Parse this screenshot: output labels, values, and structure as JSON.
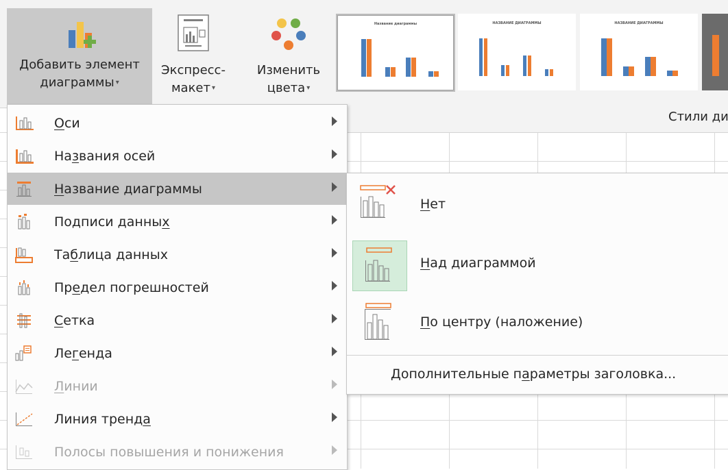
{
  "ribbon": {
    "add_element": {
      "line1": "Добавить элемент",
      "line2": "диаграммы"
    },
    "express_layout": {
      "line1": "Экспресс-",
      "line2": "макет"
    },
    "change_colors": {
      "line1": "Изменить",
      "line2": "цвета"
    },
    "gallery": [
      {
        "title": "Название диаграммы"
      },
      {
        "title": "НАЗВАНИЕ ДИАГРАММЫ"
      },
      {
        "title": "НАЗВАНИЕ ДИАГРАММЫ"
      }
    ],
    "styles_label": "Стили ди"
  },
  "menu": {
    "items": [
      {
        "pre": "",
        "u": "О",
        "post": "си",
        "icon": "axes-icon",
        "disabled": false
      },
      {
        "pre": "На",
        "u": "з",
        "post": "вания осей",
        "icon": "axis-titles-icon",
        "disabled": false
      },
      {
        "pre": "",
        "u": "Н",
        "post": "азвание диаграммы",
        "icon": "chart-title-icon",
        "disabled": false,
        "highlighted": true
      },
      {
        "pre": "Подписи данны",
        "u": "х",
        "post": "",
        "icon": "data-labels-icon",
        "disabled": false
      },
      {
        "pre": "Та",
        "u": "б",
        "post": "лица данных",
        "icon": "data-table-icon",
        "disabled": false
      },
      {
        "pre": "Пр",
        "u": "е",
        "post": "дел погрешностей",
        "icon": "error-bars-icon",
        "disabled": false
      },
      {
        "pre": "",
        "u": "С",
        "post": "етка",
        "icon": "gridlines-icon",
        "disabled": false
      },
      {
        "pre": "Ле",
        "u": "г",
        "post": "енда",
        "icon": "legend-icon",
        "disabled": false
      },
      {
        "pre": "",
        "u": "Л",
        "post": "инии",
        "icon": "lines-icon",
        "disabled": true
      },
      {
        "pre": "Линия тренд",
        "u": "а",
        "post": "",
        "icon": "trendline-icon",
        "disabled": false
      },
      {
        "pre": "Полосы повышения и понижения",
        "u": "",
        "post": "",
        "icon": "up-down-bars-icon",
        "disabled": true
      }
    ]
  },
  "submenu": {
    "items": [
      {
        "pre": "",
        "u": "Н",
        "post": "ет",
        "icon": "no-title-icon"
      },
      {
        "pre": "",
        "u": "Н",
        "post": "ад диаграммой",
        "icon": "above-chart-icon",
        "selected": true
      },
      {
        "pre": "",
        "u": "П",
        "post": "о центру (наложение)",
        "icon": "centered-overlay-icon"
      }
    ],
    "more": {
      "pre": "Дополнительные п",
      "u": "а",
      "post": "раметры заголовка..."
    }
  },
  "colors": {
    "accent_orange": "#ed7d31",
    "accent_blue": "#4a7ebb",
    "highlight": "#c6c6c6",
    "selected_green": "#d5eddb"
  }
}
